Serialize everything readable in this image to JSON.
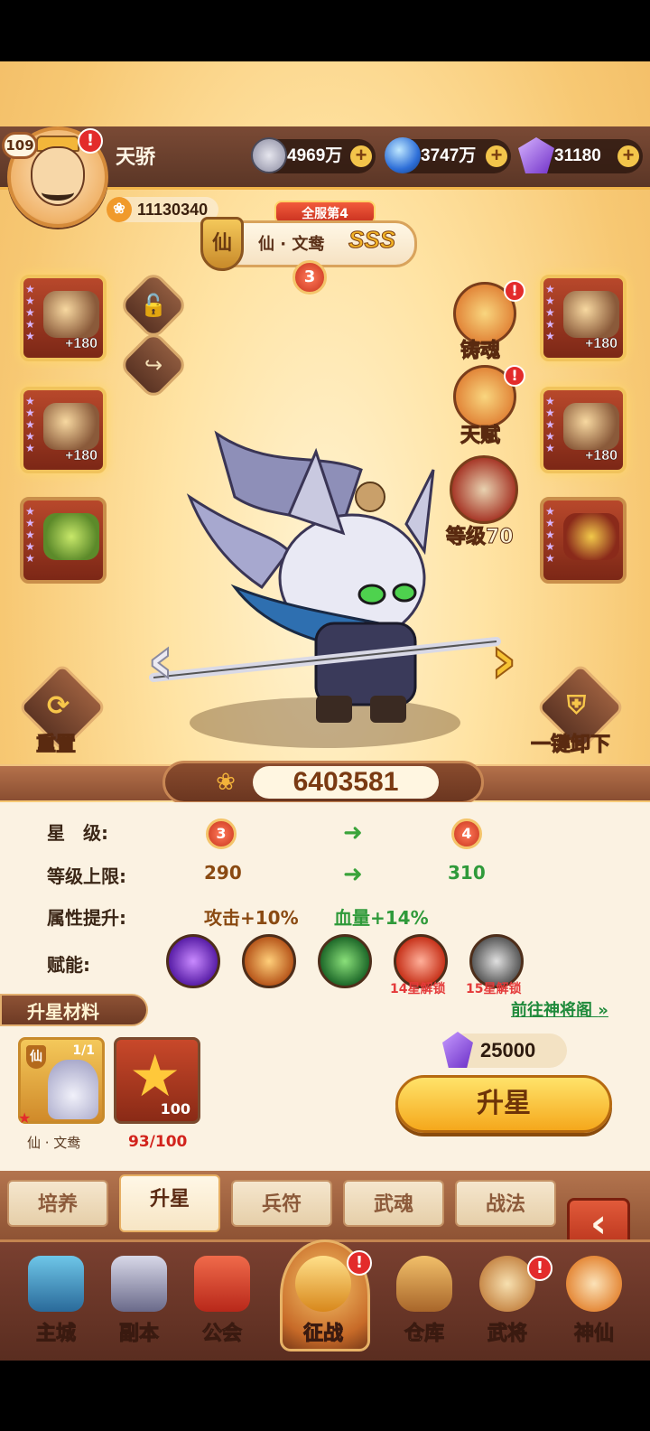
{
  "player": {
    "level": "109",
    "name": "天骄",
    "power": "11130340"
  },
  "currencies": [
    {
      "icon": "coin-icon",
      "value": "4969万"
    },
    {
      "icon": "orb-icon",
      "value": "3747万"
    },
    {
      "icon": "gem-icon",
      "value": "31180"
    }
  ],
  "hero": {
    "server_rank": "全服第4",
    "class_tag": "仙",
    "name": "仙 · 文鸯",
    "grade": "SSS",
    "stars": "3",
    "combat_power": "6403581"
  },
  "equipment": {
    "left": [
      {
        "bonus": "+180"
      },
      {
        "bonus": "+180"
      },
      {
        "bonus": ""
      }
    ],
    "right": [
      {
        "bonus": "+180"
      },
      {
        "bonus": "+180"
      },
      {
        "bonus": ""
      }
    ]
  },
  "side_actions": {
    "forge_soul": "铸魂",
    "talent": "天赋",
    "level": "等级70"
  },
  "buttons": {
    "reset": "重置",
    "unequip_all": "一键卸下",
    "ascend": "升星",
    "goto": "前往神将阁"
  },
  "stats": {
    "star_label": "星　级:",
    "star_from": "3",
    "star_to": "4",
    "level_cap_label": "等级上限:",
    "level_cap_from": "290",
    "level_cap_to": "310",
    "attr_label": "属性提升:",
    "attr_attack": "攻击+10%",
    "attr_hp": "血量+14%",
    "empower_label": "赋能:"
  },
  "skills": [
    {
      "icon": "purple-spell-icon",
      "lock": ""
    },
    {
      "icon": "flame-warrior-icon",
      "lock": ""
    },
    {
      "icon": "green-swords-icon",
      "lock": ""
    },
    {
      "icon": "red-fighter-icon",
      "lock": "14星解锁"
    },
    {
      "icon": "gray-fighter-icon",
      "lock": "15星解锁"
    }
  ],
  "materials": {
    "title": "升星材料",
    "hero_card": {
      "count": "1/1",
      "class_tag": "仙",
      "name": "仙 · 文鸯"
    },
    "star_card": {
      "amount": "100",
      "progress": "93/100"
    },
    "cost": "25000"
  },
  "subtabs": [
    "培养",
    "升星",
    "兵符",
    "武魂",
    "战法"
  ],
  "active_subtab": "升星",
  "nav": [
    {
      "label": "主城",
      "icon": "castle-icon"
    },
    {
      "label": "副本",
      "icon": "sword-icon"
    },
    {
      "label": "公会",
      "icon": "flag-icon"
    },
    {
      "label": "征战",
      "icon": "battle-icon"
    },
    {
      "label": "仓库",
      "icon": "bag-icon"
    },
    {
      "label": "武将",
      "icon": "hero-cat-icon"
    },
    {
      "label": "神仙",
      "icon": "god-cat-icon"
    }
  ],
  "colors": {
    "accent_gold": "#f5a81c",
    "panel_brown": "#7a4030",
    "alert_red": "#e32b2b",
    "link_green": "#1f8a3b"
  }
}
